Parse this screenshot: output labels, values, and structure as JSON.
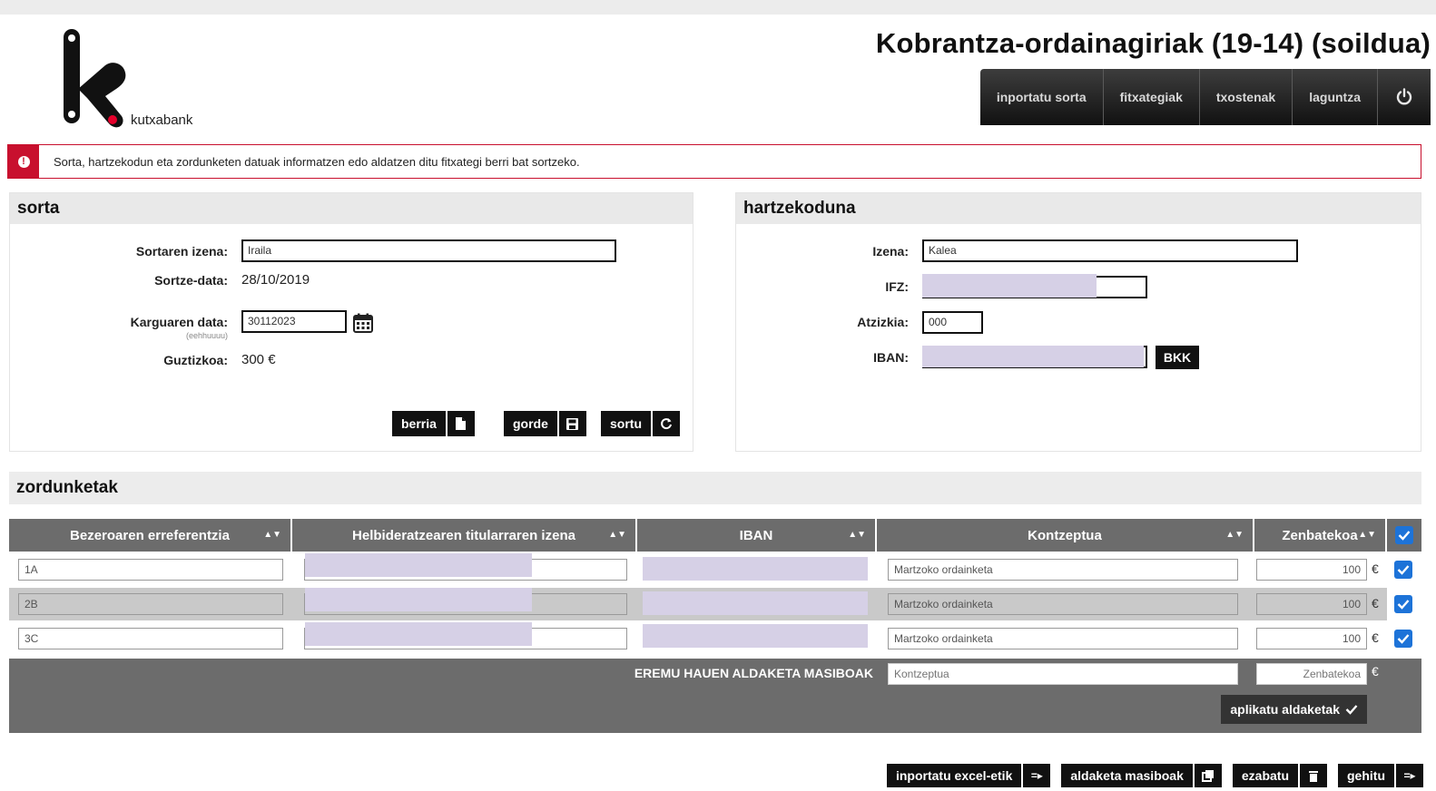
{
  "header": {
    "logo_text": "kutxabank",
    "title": "Kobrantza-ordainagiriak (19-14) (soildua)",
    "nav": [
      "inportatu sorta",
      "fitxategiak",
      "txostenak",
      "laguntza"
    ]
  },
  "alert": {
    "icon": "!",
    "text": "Sorta, hartzekodun eta zordunketen datuak informatzen edo aldatzen ditu fitxategi berri bat sortzeko."
  },
  "sorta": {
    "title": "sorta",
    "name_label": "Sortaren izena:",
    "name_value": "Iraila",
    "created_label": "Sortze-data:",
    "created_value": "28/10/2019",
    "charge_label": "Karguaren data:",
    "charge_hint": "(eehhuuuu)",
    "charge_value": "30112023",
    "total_label": "Guztizkoa:",
    "total_value": "300 €",
    "buttons": {
      "new": "berria",
      "save": "gorde",
      "create": "sortu"
    }
  },
  "hartzekoduna": {
    "title": "hartzekoduna",
    "name_label": "Izena:",
    "name_value": "Kalea",
    "ifz_label": "IFZ:",
    "suffix_label": "Atzizkia:",
    "suffix_value": "000",
    "iban_label": "IBAN:",
    "bank_code": "BKK"
  },
  "zordunketak": {
    "title": "zordunketak",
    "columns": [
      "Bezeroaren erreferentzia",
      "Helbideratzearen titularraren izena",
      "IBAN",
      "Kontzeptua",
      "Zenbatekoa"
    ],
    "rows": [
      {
        "ref": "1A",
        "concept": "Martzoko ordainketa",
        "amount": "100"
      },
      {
        "ref": "2B",
        "concept": "Martzoko ordainketa",
        "amount": "100"
      },
      {
        "ref": "3C",
        "concept": "Martzoko ordainketa",
        "amount": "100"
      }
    ],
    "currency": "€",
    "mass": {
      "label": "EREMU HAUEN ALDAKETA MASIBOAK",
      "concept_placeholder": "Kontzeptua",
      "amount_placeholder": "Zenbatekoa",
      "apply": "aplikatu aldaketak"
    }
  },
  "footer_buttons": {
    "import_excel": "inportatu excel-etik",
    "mass_edit": "aldaketa masiboak",
    "delete": "ezabatu",
    "add": "gehitu"
  },
  "colors": {
    "accent_red": "#c8102e",
    "checkbox_blue": "#1d73d8",
    "table_header": "#6c6c6c"
  }
}
